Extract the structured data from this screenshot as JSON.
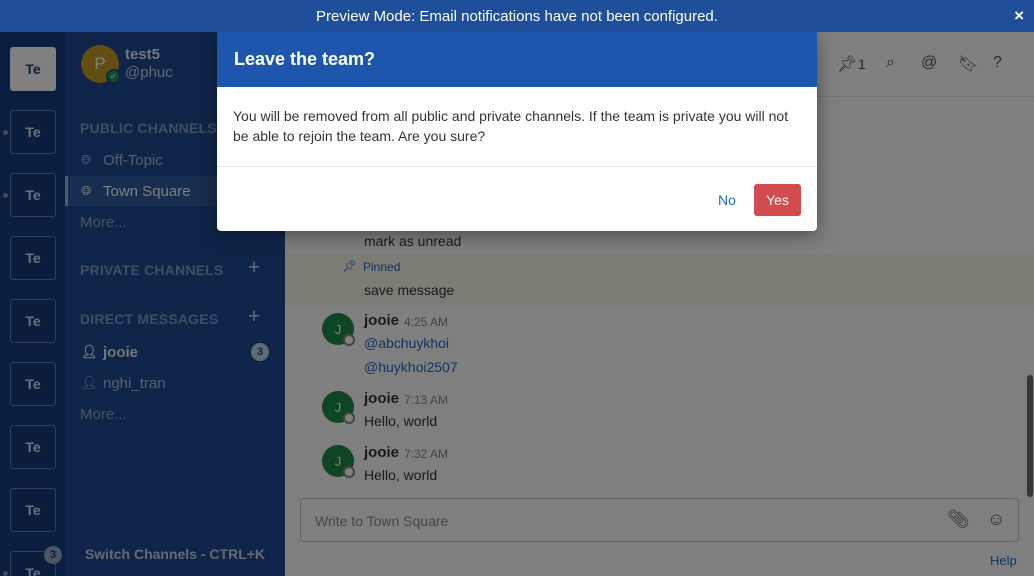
{
  "banner": {
    "text": "Preview Mode: Email notifications have not been configured.",
    "close_icon": "×"
  },
  "teams": {
    "items": [
      "Te",
      "Te",
      "Te",
      "Te",
      "Te",
      "Te",
      "Te",
      "Te",
      "Te"
    ],
    "badge": "3"
  },
  "user": {
    "name": "test5",
    "handle": "@phuc",
    "avatar_letter": "P"
  },
  "sidebar": {
    "public_title": "PUBLIC CHANNELS",
    "public_channels": [
      {
        "label": "Off-Topic"
      },
      {
        "label": "Town Square"
      }
    ],
    "public_more": "More...",
    "private_title": "PRIVATE CHANNELS",
    "dm_title": "DIRECT MESSAGES",
    "direct_messages": [
      {
        "label": "jooie",
        "badge": "3"
      },
      {
        "label": "nghi_tran"
      }
    ],
    "dm_more": "More...",
    "switch": "Switch Channels - CTRL+K"
  },
  "header": {
    "pinned_count": "1"
  },
  "messages": {
    "unread_text": "mark as unread",
    "pinned_label": "Pinned",
    "pinned_text": "save message",
    "posts": [
      {
        "author": "jooie",
        "time": "4:25 AM",
        "avatar": "J",
        "lines": [
          "@abchuykhoi",
          "@huykhoi2507"
        ]
      },
      {
        "author": "jooie",
        "time": "7:13 AM",
        "avatar": "J",
        "text": "Hello, world"
      },
      {
        "author": "jooie",
        "time": "7:32 AM",
        "avatar": "J",
        "text": "Hello, world"
      }
    ]
  },
  "composer": {
    "placeholder": "Write to Town Square"
  },
  "help": "Help",
  "modal": {
    "title": "Leave the team?",
    "body": "You will be removed from all public and private channels. If the team is private you will not be able to rejoin the team. Are you sure?",
    "no_label": "No",
    "yes_label": "Yes"
  },
  "colors": {
    "brand": "#1e56ad",
    "danger": "#d24b4e",
    "sidebar": "#1d4a93"
  }
}
